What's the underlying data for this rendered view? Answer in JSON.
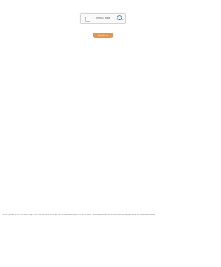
{
  "recaptcha": {
    "label": "I'm not a robot",
    "icon": "recaptcha-icon",
    "terms": "Privacy - Terms"
  },
  "confirm_button": {
    "label": "Confirm",
    "color": "#e8944a"
  },
  "footer": {
    "text": "This site is protected by reCAPTCHA and the Google Privacy Policy and Terms of Service apply. Please complete the security check to access the website. Confirm that you are not a robot to continue to the requested page and verify your browser before proceeding."
  }
}
